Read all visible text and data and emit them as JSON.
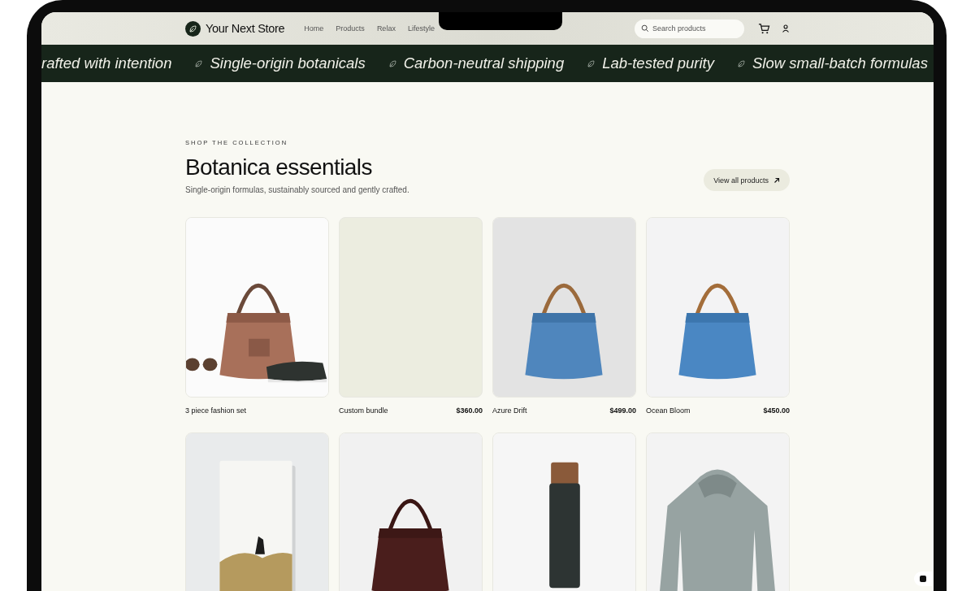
{
  "header": {
    "store_name": "Your Next Store",
    "nav": [
      "Home",
      "Products",
      "Relax",
      "Lifestyle"
    ],
    "search": {
      "placeholder": "Search products"
    }
  },
  "marquee": [
    {
      "text": "rafted with intention",
      "icon": false
    },
    {
      "text": "Single-origin botanicals",
      "icon": true
    },
    {
      "text": "Carbon-neutral shipping",
      "icon": true
    },
    {
      "text": "Lab-tested purity",
      "icon": true
    },
    {
      "text": "Slow small-batch formulas",
      "icon": true
    }
  ],
  "section": {
    "eyebrow": "SHOP THE COLLECTION",
    "title": "Botanica essentials",
    "subtitle": "Single-origin formulas, sustainably sourced and gently crafted.",
    "button": "View all products"
  },
  "products": [
    {
      "kind": "picture",
      "name": "3 piece fashion set"
    },
    {
      "kind": "blank",
      "name": "Custom bundle",
      "price": "$360.00"
    },
    {
      "kind": "picture",
      "name": "Azure Drift",
      "price": "$499.00"
    },
    {
      "kind": "picture",
      "name": "Ocean Bloom",
      "price": "$450.00"
    },
    {
      "kind": "picture"
    },
    {
      "kind": "picture"
    },
    {
      "kind": "picture"
    },
    {
      "kind": "picture"
    }
  ]
}
